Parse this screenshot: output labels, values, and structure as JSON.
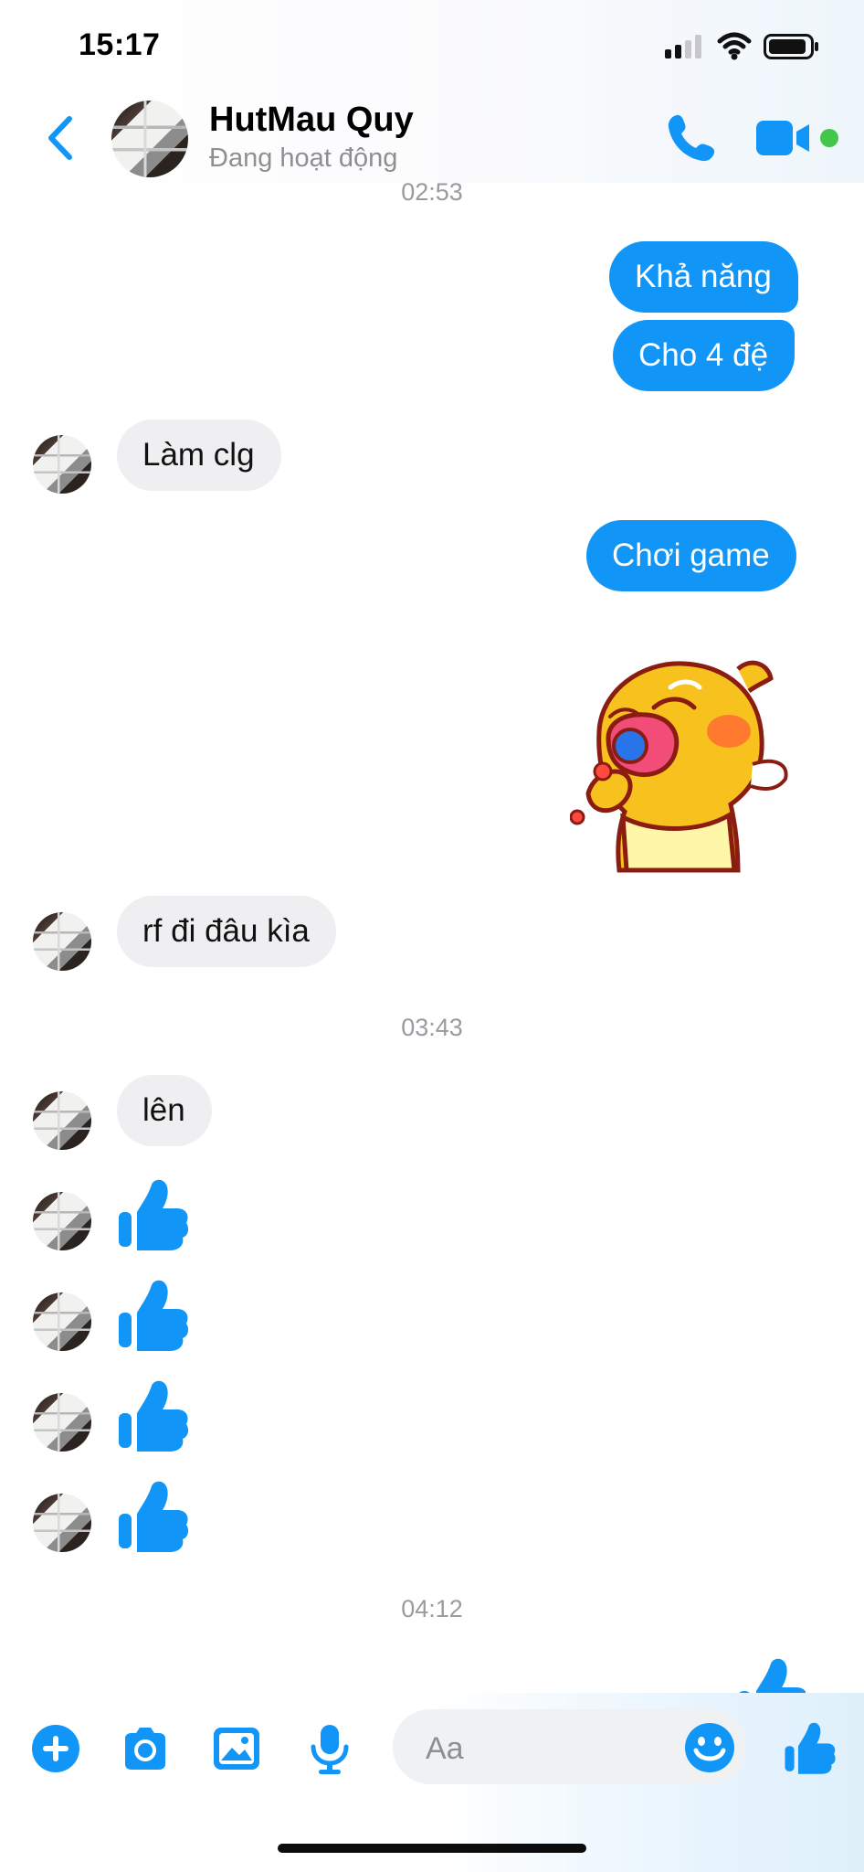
{
  "status_bar": {
    "time": "15:17",
    "icons": [
      "cellular-signal-icon",
      "wifi-icon",
      "battery-icon"
    ]
  },
  "header": {
    "contact_name": "HutMau Quy",
    "status": "Đang hoạt động",
    "actions": [
      "back-icon",
      "phone-icon",
      "video-call-icon"
    ],
    "online_indicator_color": "#43c64b"
  },
  "messages": [
    {
      "type": "timestamp",
      "text": "02:53"
    },
    {
      "type": "outgoing",
      "text": "Khả năng"
    },
    {
      "type": "outgoing",
      "text": "Cho 4 đệ"
    },
    {
      "type": "incoming",
      "text": "Làm clg"
    },
    {
      "type": "outgoing",
      "text": "Chơi game"
    },
    {
      "type": "outgoing_sticker",
      "sticker": "yellow-creature-crying-sticker"
    },
    {
      "type": "incoming",
      "text": "rf đi đâu kìa"
    },
    {
      "type": "timestamp",
      "text": "03:43"
    },
    {
      "type": "incoming",
      "text": "lên"
    },
    {
      "type": "incoming_like",
      "icon": "thumbs-up-icon"
    },
    {
      "type": "incoming_like",
      "icon": "thumbs-up-icon"
    },
    {
      "type": "incoming_like",
      "icon": "thumbs-up-icon"
    },
    {
      "type": "incoming_like",
      "icon": "thumbs-up-icon"
    },
    {
      "type": "timestamp",
      "text": "04:12"
    },
    {
      "type": "outgoing_like_partial",
      "icon": "thumbs-up-icon"
    }
  ],
  "composer": {
    "placeholder": "Aa",
    "actions": [
      "plus-icon",
      "camera-icon",
      "image-icon",
      "microphone-icon",
      "emoji-icon",
      "thumbs-up-icon"
    ]
  },
  "colors": {
    "accent": "#1196f7",
    "incoming_bubble": "#efeff1",
    "timestamp": "#9a9aa0"
  }
}
